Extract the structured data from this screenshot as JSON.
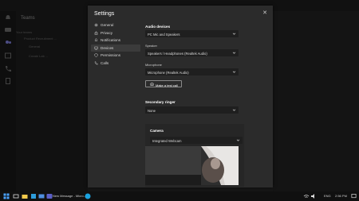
{
  "background": {
    "panel_title": "Teams",
    "faint_items": [
      "Your teams",
      "Product Recruitment ...",
      "General",
      "Create Lab ..."
    ]
  },
  "dialog": {
    "title": "Settings",
    "close_glyph": "✕",
    "nav": [
      {
        "label": "General",
        "icon": "gear-icon",
        "active": false
      },
      {
        "label": "Privacy",
        "icon": "lock-icon",
        "active": false
      },
      {
        "label": "Notifications",
        "icon": "bell-icon",
        "active": false
      },
      {
        "label": "Devices",
        "icon": "device-icon",
        "active": true
      },
      {
        "label": "Permissions",
        "icon": "shield-icon",
        "active": false
      },
      {
        "label": "Calls",
        "icon": "phone-icon",
        "active": false
      }
    ],
    "audio": {
      "heading": "Audio devices",
      "device_value": "PC Mic and Speakers",
      "speaker_label": "Speaker",
      "speaker_value": "Speakers / Headphones (Realtek Audio)",
      "mic_label": "Microphone",
      "mic_value": "Microphone (Realtek Audio)",
      "test_call_label": "Make a test call"
    },
    "ringer": {
      "heading": "Secondary ringer",
      "value": "None"
    },
    "camera": {
      "heading": "Camera",
      "value": "Integrated Webcam"
    }
  },
  "taskbar": {
    "window_title": "New Message - Micro...",
    "language": "ENG",
    "time": "2:56 PM"
  },
  "colors": {
    "accent": "#5b5fc7",
    "dialog_bg": "#2b2b2b",
    "dropdown_bg": "#1f1f1f"
  }
}
